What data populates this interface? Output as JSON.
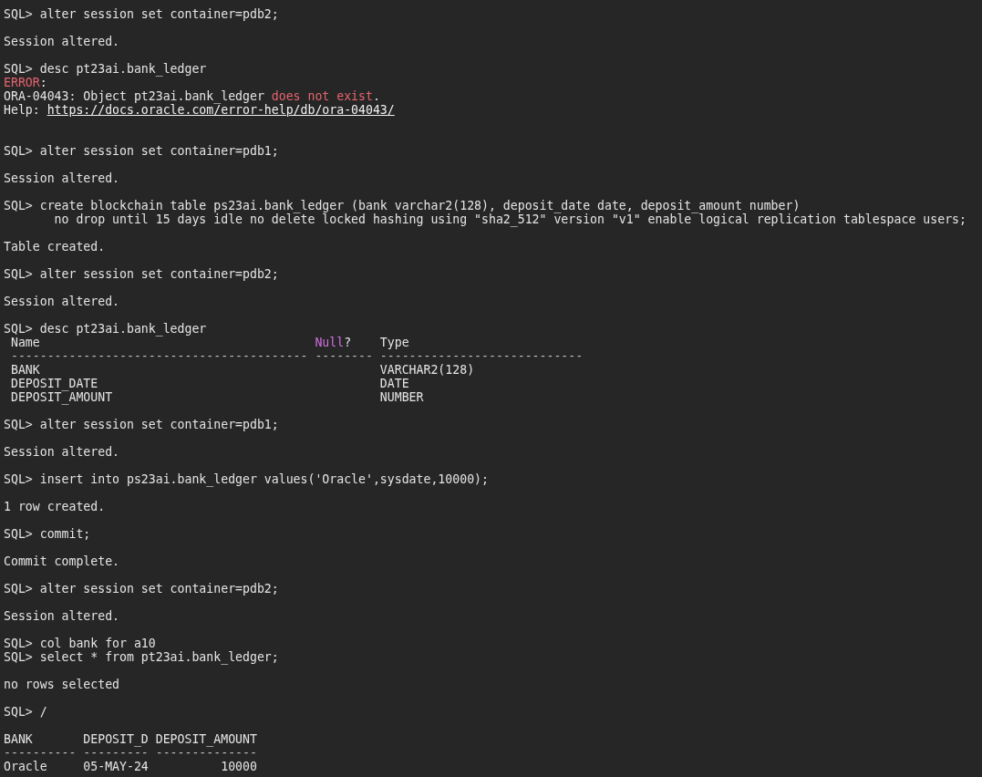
{
  "lines": [
    {
      "kind": "text",
      "segments": [
        {
          "kind": "plain",
          "text": "SQL> alter session set container=pdb2;"
        }
      ]
    },
    {
      "kind": "blank"
    },
    {
      "kind": "text",
      "segments": [
        {
          "kind": "plain",
          "text": "Session altered."
        }
      ]
    },
    {
      "kind": "blank"
    },
    {
      "kind": "text",
      "segments": [
        {
          "kind": "plain",
          "text": "SQL> desc pt23ai.bank_ledger"
        }
      ]
    },
    {
      "kind": "text",
      "segments": [
        {
          "kind": "error",
          "text": "ERROR"
        },
        {
          "kind": "plain",
          "text": ":"
        }
      ]
    },
    {
      "kind": "text",
      "segments": [
        {
          "kind": "plain",
          "text": "ORA-04043: Object pt23ai.bank_ledger "
        },
        {
          "kind": "error",
          "text": "does not exist"
        },
        {
          "kind": "plain",
          "text": "."
        }
      ]
    },
    {
      "kind": "text",
      "segments": [
        {
          "kind": "plain",
          "text": "Help: "
        },
        {
          "kind": "link",
          "text": "https://docs.oracle.com/error-help/db/ora-04043/"
        }
      ]
    },
    {
      "kind": "blank"
    },
    {
      "kind": "blank"
    },
    {
      "kind": "text",
      "segments": [
        {
          "kind": "plain",
          "text": "SQL> alter session set container=pdb1;"
        }
      ]
    },
    {
      "kind": "blank"
    },
    {
      "kind": "text",
      "segments": [
        {
          "kind": "plain",
          "text": "Session altered."
        }
      ]
    },
    {
      "kind": "blank"
    },
    {
      "kind": "text",
      "segments": [
        {
          "kind": "plain",
          "text": "SQL> create blockchain table ps23ai.bank_ledger (bank varchar2(128), deposit_date date, deposit_amount number)"
        }
      ]
    },
    {
      "kind": "text",
      "segments": [
        {
          "kind": "plain",
          "text": "       no drop until 15 days idle no delete locked hashing using \"sha2_512\" version \"v1\" enable logical replication tablespace users;"
        }
      ]
    },
    {
      "kind": "blank"
    },
    {
      "kind": "text",
      "segments": [
        {
          "kind": "plain",
          "text": "Table created."
        }
      ]
    },
    {
      "kind": "blank"
    },
    {
      "kind": "text",
      "segments": [
        {
          "kind": "plain",
          "text": "SQL> alter session set container=pdb2;"
        }
      ]
    },
    {
      "kind": "blank"
    },
    {
      "kind": "text",
      "segments": [
        {
          "kind": "plain",
          "text": "Session altered."
        }
      ]
    },
    {
      "kind": "blank"
    },
    {
      "kind": "text",
      "segments": [
        {
          "kind": "plain",
          "text": "SQL> desc pt23ai.bank_ledger"
        }
      ]
    },
    {
      "kind": "text",
      "segments": [
        {
          "kind": "plain",
          "text": " Name                                      "
        },
        {
          "kind": "keyword",
          "text": "Null"
        },
        {
          "kind": "plain",
          "text": "?    Type"
        }
      ]
    },
    {
      "kind": "text",
      "segments": [
        {
          "kind": "rule",
          "text": " ----------------------------------------- -------- ----------------------------"
        }
      ]
    },
    {
      "kind": "text",
      "segments": [
        {
          "kind": "plain",
          "text": " BANK                                               VARCHAR2(128)"
        }
      ]
    },
    {
      "kind": "text",
      "segments": [
        {
          "kind": "plain",
          "text": " DEPOSIT_DATE                                       DATE"
        }
      ]
    },
    {
      "kind": "text",
      "segments": [
        {
          "kind": "plain",
          "text": " DEPOSIT_AMOUNT                                     NUMBER"
        }
      ]
    },
    {
      "kind": "blank"
    },
    {
      "kind": "text",
      "segments": [
        {
          "kind": "plain",
          "text": "SQL> alter session set container=pdb1;"
        }
      ]
    },
    {
      "kind": "blank"
    },
    {
      "kind": "text",
      "segments": [
        {
          "kind": "plain",
          "text": "Session altered."
        }
      ]
    },
    {
      "kind": "blank"
    },
    {
      "kind": "text",
      "segments": [
        {
          "kind": "plain",
          "text": "SQL> insert into ps23ai.bank_ledger values('Oracle',sysdate,10000);"
        }
      ]
    },
    {
      "kind": "blank"
    },
    {
      "kind": "text",
      "segments": [
        {
          "kind": "plain",
          "text": "1 row created."
        }
      ]
    },
    {
      "kind": "blank"
    },
    {
      "kind": "text",
      "segments": [
        {
          "kind": "plain",
          "text": "SQL> commit;"
        }
      ]
    },
    {
      "kind": "blank"
    },
    {
      "kind": "text",
      "segments": [
        {
          "kind": "plain",
          "text": "Commit complete."
        }
      ]
    },
    {
      "kind": "blank"
    },
    {
      "kind": "text",
      "segments": [
        {
          "kind": "plain",
          "text": "SQL> alter session set container=pdb2;"
        }
      ]
    },
    {
      "kind": "blank"
    },
    {
      "kind": "text",
      "segments": [
        {
          "kind": "plain",
          "text": "Session altered."
        }
      ]
    },
    {
      "kind": "blank"
    },
    {
      "kind": "text",
      "segments": [
        {
          "kind": "plain",
          "text": "SQL> col bank for a10"
        }
      ]
    },
    {
      "kind": "text",
      "segments": [
        {
          "kind": "plain",
          "text": "SQL> select * from pt23ai.bank_ledger;"
        }
      ]
    },
    {
      "kind": "blank"
    },
    {
      "kind": "text",
      "segments": [
        {
          "kind": "plain",
          "text": "no rows selected"
        }
      ]
    },
    {
      "kind": "blank"
    },
    {
      "kind": "text",
      "segments": [
        {
          "kind": "plain",
          "text": "SQL> /"
        }
      ]
    },
    {
      "kind": "blank"
    },
    {
      "kind": "text",
      "segments": [
        {
          "kind": "plain",
          "text": "BANK       DEPOSIT_D DEPOSIT_AMOUNT"
        }
      ]
    },
    {
      "kind": "text",
      "segments": [
        {
          "kind": "rule",
          "text": "---------- --------- --------------"
        }
      ]
    },
    {
      "kind": "text",
      "segments": [
        {
          "kind": "plain",
          "text": "Oracle     05-MAY-24          10000"
        }
      ]
    }
  ]
}
